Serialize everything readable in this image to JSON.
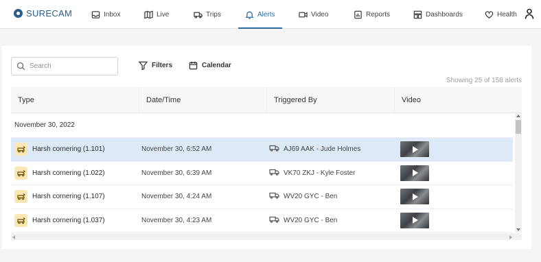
{
  "brand": {
    "name": "SURECAM"
  },
  "nav": {
    "items": [
      {
        "label": "Inbox",
        "icon": "inbox-icon"
      },
      {
        "label": "Live",
        "icon": "map-icon"
      },
      {
        "label": "Trips",
        "icon": "truck-icon"
      },
      {
        "label": "Alerts",
        "icon": "bell-icon",
        "active": true
      },
      {
        "label": "Video",
        "icon": "video-icon"
      },
      {
        "label": "Reports",
        "icon": "report-icon"
      },
      {
        "label": "Dashboards",
        "icon": "dashboard-icon"
      },
      {
        "label": "Health",
        "icon": "heart-icon"
      }
    ],
    "user_icon": "user-icon"
  },
  "toolbar": {
    "search_placeholder": "Search",
    "filters_label": "Filters",
    "calendar_label": "Calendar",
    "showing_text": "Showing 25 of 158 alerts"
  },
  "table": {
    "columns": [
      "Type",
      "Date/Time",
      "Triggered By",
      "Video"
    ],
    "group_label": "November 30, 2022",
    "rows": [
      {
        "type": "Harsh cornering (1.101)",
        "datetime": "November 30, 6:52 AM",
        "triggered_by": "AJ69 AAK - Jude Holmes",
        "selected": true
      },
      {
        "type": "Harsh cornering (1.022)",
        "datetime": "November 30, 6:39 AM",
        "triggered_by": "VK70 ZKJ - Kyle Foster",
        "selected": false
      },
      {
        "type": "Harsh cornering (1.107)",
        "datetime": "November 30, 4:24 AM",
        "triggered_by": "WV20 GYC - Ben",
        "selected": false
      },
      {
        "type": "Harsh cornering (1.037)",
        "datetime": "November 30, 4:23 AM",
        "triggered_by": "WV20 GYC - Ben",
        "selected": false
      }
    ]
  },
  "colors": {
    "accent": "#2b6ca3",
    "selected_row": "#dde9f6",
    "type_badge": "#fbe7b4"
  }
}
